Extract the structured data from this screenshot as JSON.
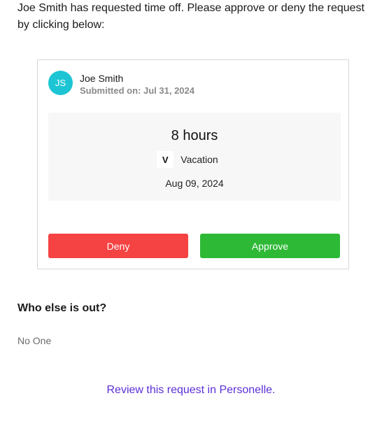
{
  "intro": {
    "text": "Joe Smith has requested time off. Please approve or deny the request by clicking below:"
  },
  "request": {
    "avatar_initials": "JS",
    "avatar_color": "#1dc5d4",
    "employee_name": "Joe Smith",
    "submitted": "Submitted on: Jul 31, 2024",
    "hours": "8 hours",
    "type_badge": "V",
    "type_label": "Vacation",
    "date": "Aug 09, 2024"
  },
  "actions": {
    "deny_label": "Deny",
    "deny_color": "#f54242",
    "approve_label": "Approve",
    "approve_color": "#2db935"
  },
  "others_out": {
    "title": "Who else is out?",
    "value": "No One"
  },
  "footer": {
    "review_link": "Review this request in Personelle.",
    "link_color": "#5b2fd6"
  }
}
